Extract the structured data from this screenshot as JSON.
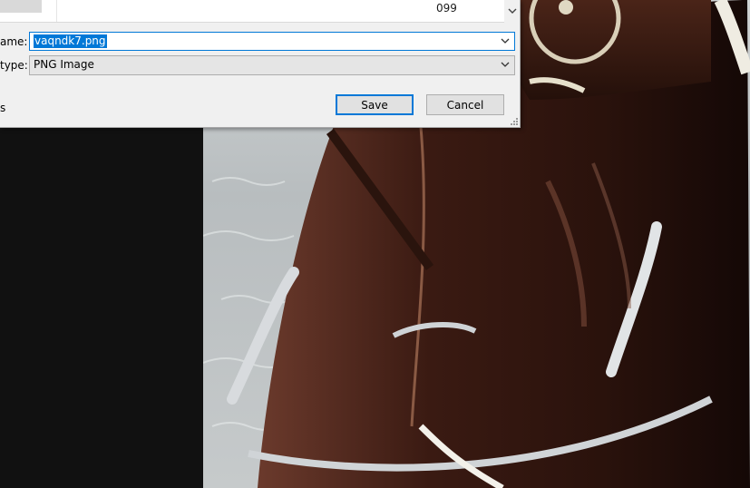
{
  "file_list": {
    "visible_fragment": "099"
  },
  "form": {
    "name_label": "ame:",
    "name_value": "vaqndk7.png",
    "type_label": "type:",
    "type_value": "PNG Image",
    "hidden_fragment": "s"
  },
  "buttons": {
    "save": "Save",
    "cancel": "Cancel"
  },
  "colors": {
    "accent": "#0078d7",
    "dialog_bg": "#f0f0f0",
    "boat_hull": "#3a1a12"
  }
}
